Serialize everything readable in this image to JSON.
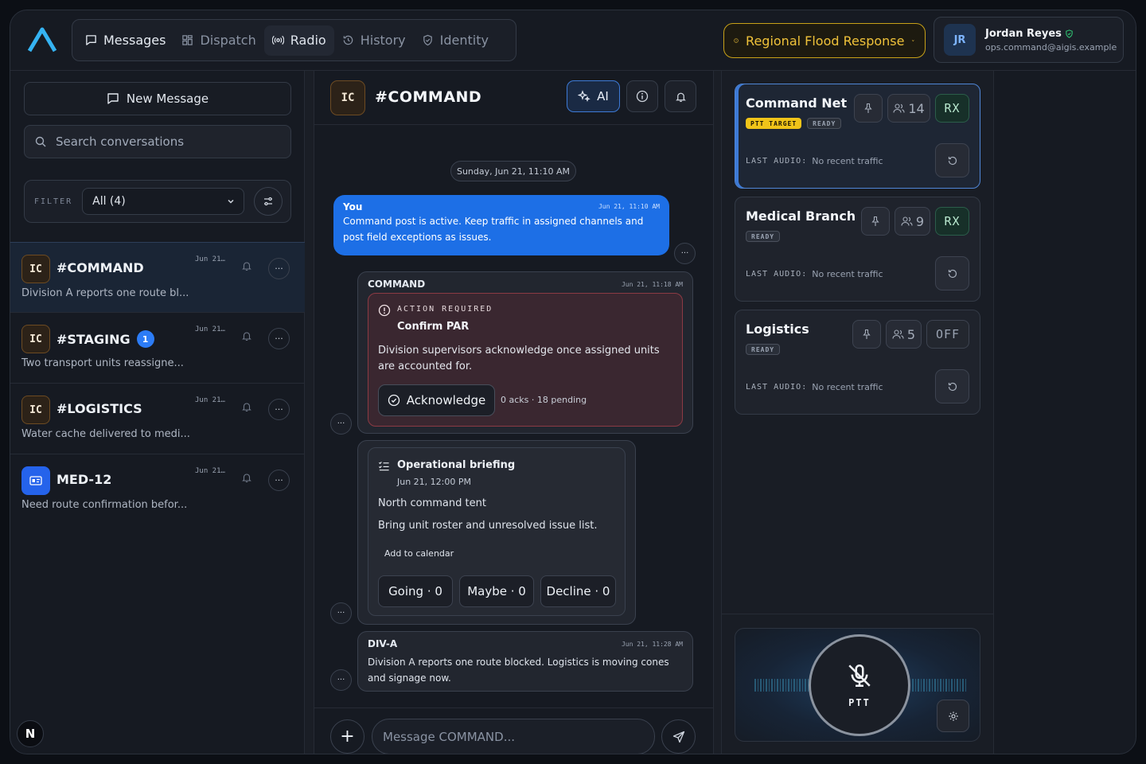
{
  "header": {
    "tabs": [
      {
        "label": "Messages",
        "icon": "message-square-icon"
      },
      {
        "label": "Dispatch",
        "icon": "grid-icon"
      },
      {
        "label": "Radio",
        "icon": "radio-broadcast-icon"
      },
      {
        "label": "History",
        "icon": "history-icon"
      },
      {
        "label": "Identity",
        "icon": "shield-check-icon"
      }
    ],
    "incident": "Regional Flood Response",
    "user": {
      "initials": "JR",
      "name": "Jordan Reyes",
      "email": "ops.command@aigis.example"
    }
  },
  "sidebar": {
    "new_message": "New Message",
    "search_placeholder": "Search conversations",
    "filter_label": "FILTER",
    "filter_value": "All (4)",
    "conversations": [
      {
        "badge": "IC",
        "name": "#COMMAND",
        "time": "Jun 21…",
        "preview": "Division A reports one route bl..."
      },
      {
        "badge": "IC",
        "name": "#STAGING",
        "unread": "1",
        "time": "Jun 21…",
        "preview": "Two transport units reassigne..."
      },
      {
        "badge": "IC",
        "name": "#LOGISTICS",
        "time": "Jun 21…",
        "preview": "Water cache delivered to medi..."
      },
      {
        "badge": "",
        "name": "MED-12",
        "time": "Jun 21…",
        "preview": "Need route confirmation befor..."
      }
    ],
    "more": "···",
    "corner_badge": "N"
  },
  "chat": {
    "badge": "IC",
    "title": "#COMMAND",
    "ai_label": "AI",
    "date_divider": "Sunday, Jun 21, 11:10 AM",
    "messages": {
      "me": {
        "sender": "You",
        "time": "Jun 21, 11:10 AM",
        "text": "Command post is active. Keep traffic in assigned channels and post field exceptions as issues."
      },
      "action": {
        "sender": "COMMAND",
        "time": "Jun 21, 11:18 AM",
        "tag": "ACTION REQUIRED",
        "title": "Confirm PAR",
        "body": "Division supervisors acknowledge once assigned units are accounted for.",
        "button": "Acknowledge",
        "status": "0 acks · 18 pending"
      },
      "briefing": {
        "title": "Operational briefing",
        "date": "Jun 21, 12:00 PM",
        "location": "North command tent",
        "note": "Bring unit roster and unresolved issue list.",
        "calendar": "Add to calendar",
        "going": "Going · 0",
        "maybe": "Maybe · 0",
        "decline": "Decline · 0"
      },
      "diva": {
        "sender": "DIV-A",
        "time": "Jun 21, 11:28 AM",
        "text": "Division A reports one route blocked. Logistics is moving cones and signage now."
      }
    },
    "composer_placeholder": "Message COMMAND...",
    "more": "···"
  },
  "radio": {
    "channels": [
      {
        "name": "Command Net",
        "ptt_target": "PTT TARGET",
        "status": "READY",
        "members": "14",
        "mode": "RX",
        "last_audio_label": "LAST AUDIO:",
        "last_audio": "No recent traffic"
      },
      {
        "name": "Medical Branch",
        "status": "READY",
        "members": "9",
        "mode": "RX",
        "last_audio_label": "LAST AUDIO:",
        "last_audio": "No recent traffic"
      },
      {
        "name": "Logistics",
        "status": "READY",
        "members": "5",
        "mode": "OFF",
        "last_audio_label": "LAST AUDIO:",
        "last_audio": "No recent traffic"
      }
    ],
    "ptt_label": "PTT"
  },
  "colors": {
    "accent": "#1d6fe6",
    "incident": "#f0c23a",
    "action_border": "#8c3a44",
    "rx_green": "#173029"
  }
}
